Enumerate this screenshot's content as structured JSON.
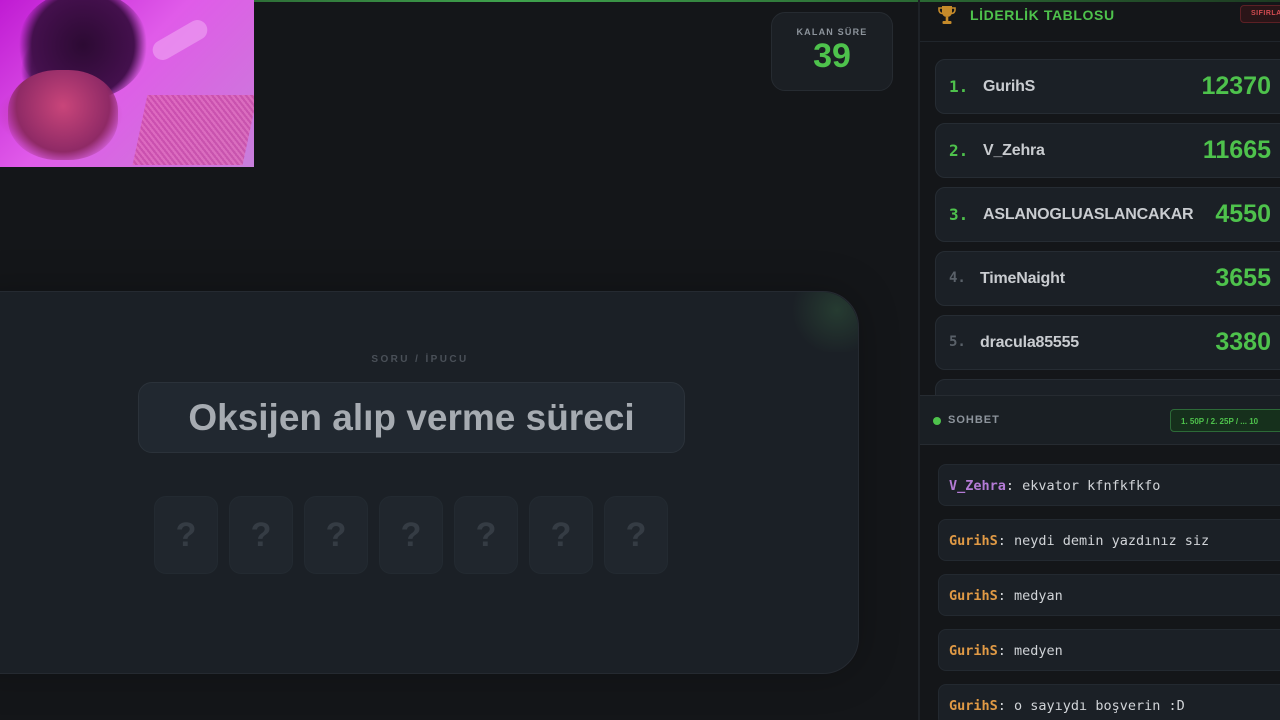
{
  "timer": {
    "label": "KALAN SÜRE",
    "value": "39"
  },
  "question": {
    "section_label": "SORU / İPUCU",
    "clue": "Oksijen alıp verme süreci",
    "tiles": [
      "?",
      "?",
      "?",
      "?",
      "?",
      "?",
      "?"
    ]
  },
  "leaderboard": {
    "title": "LİDERLİK TABLOSU",
    "reset_label": "SIFIRLA",
    "rows": [
      {
        "rank": "1.",
        "name": "GurihS",
        "score": "12370"
      },
      {
        "rank": "2.",
        "name": "V_Zehra",
        "score": "11665"
      },
      {
        "rank": "3.",
        "name": "ASLANOGLUASLANCAKAR",
        "score": "4550"
      },
      {
        "rank": "4.",
        "name": "TimeNaight",
        "score": "3655"
      },
      {
        "rank": "5.",
        "name": "dracula85555",
        "score": "3380"
      }
    ]
  },
  "chat": {
    "title": "SOHBET",
    "points_info": "1. 50P / 2. 25P / ... 10",
    "messages": [
      {
        "user": "V_Zehra",
        "text": ": ekvator kfnfkfkfo",
        "color": "#b47bd6"
      },
      {
        "user": "GurihS",
        "text": ": neydi demin yazdınız siz",
        "color": "#e19a45"
      },
      {
        "user": "GurihS",
        "text": ": medyan",
        "color": "#e19a45"
      },
      {
        "user": "GurihS",
        "text": ": medyen",
        "color": "#e19a45"
      },
      {
        "user": "GurihS",
        "text": ": o sayıydı boşverin :D",
        "color": "#e19a45"
      }
    ]
  },
  "colors": {
    "accent_green": "#4ec24c",
    "background": "#141619",
    "card": "#1b2026"
  }
}
